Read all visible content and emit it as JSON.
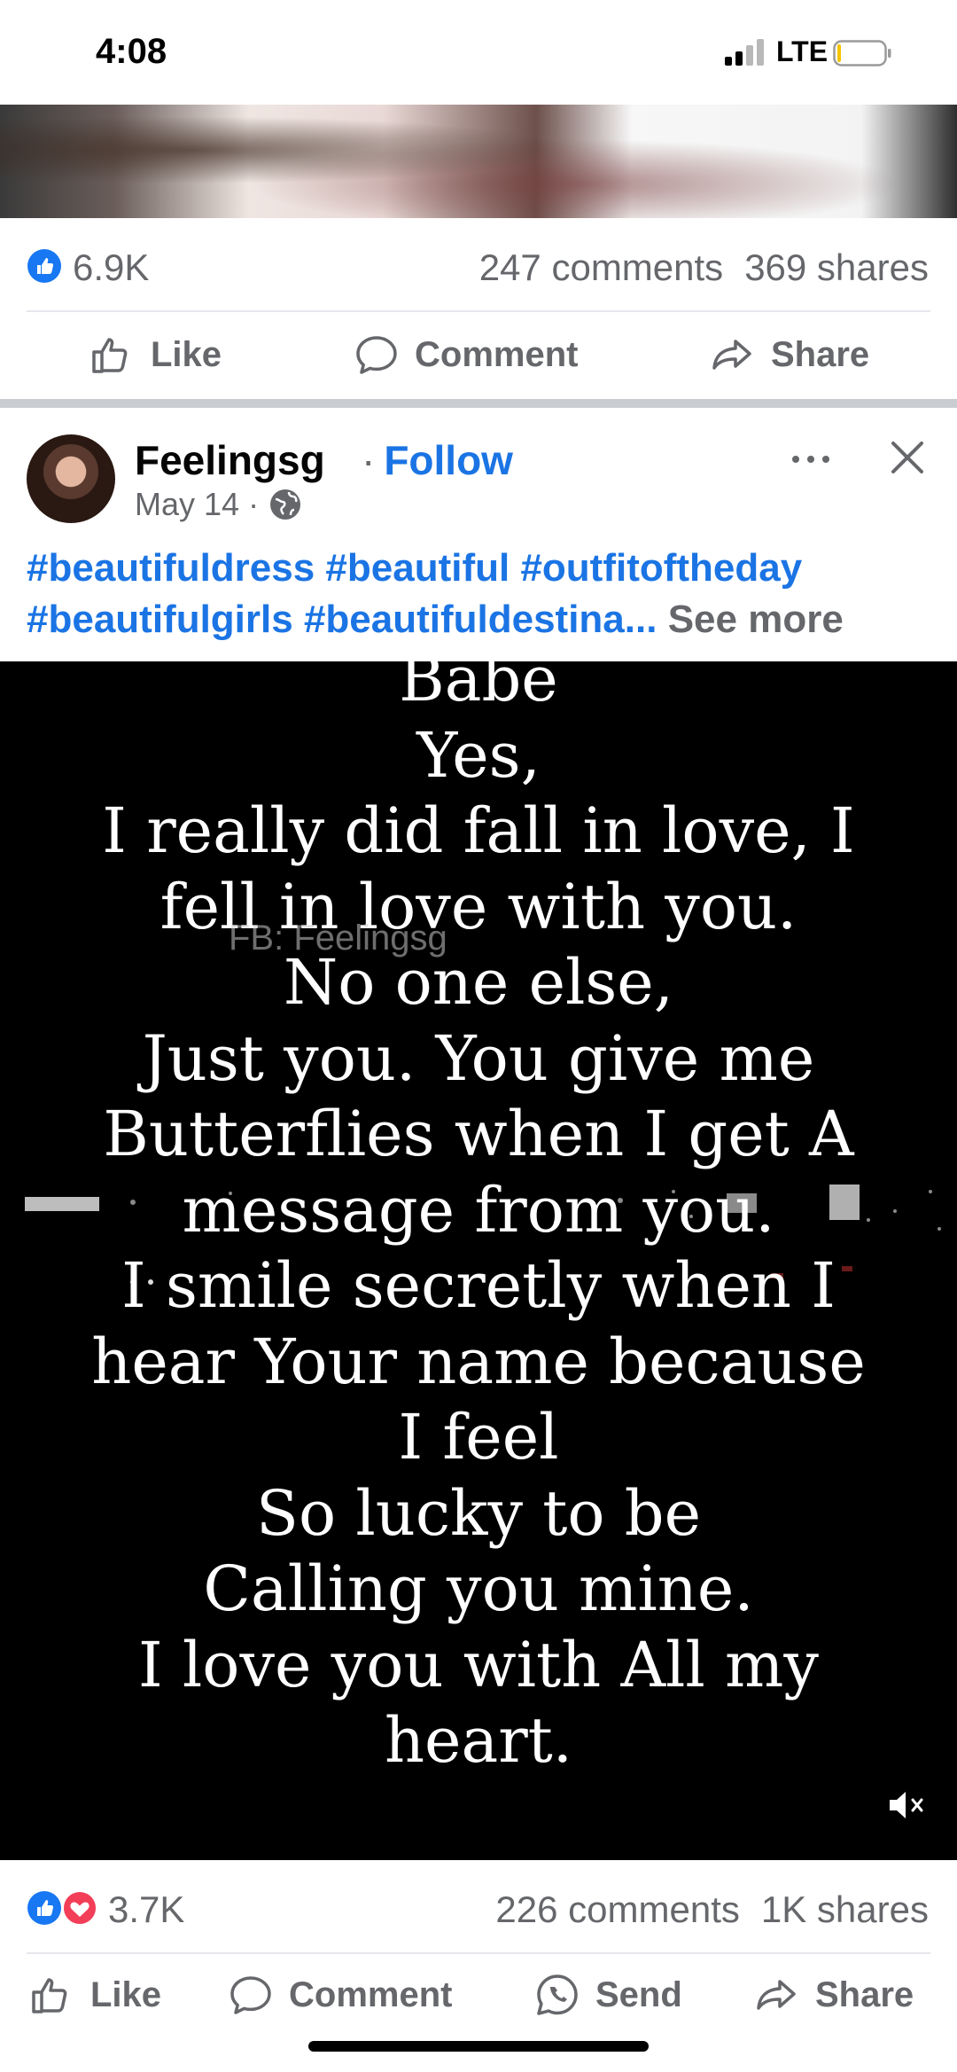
{
  "status_bar": {
    "time": "4:08",
    "network": "LTE"
  },
  "post1": {
    "reaction_count": "6.9K",
    "comments": "247 comments",
    "shares": "369 shares",
    "actions": {
      "like": "Like",
      "comment": "Comment",
      "share": "Share"
    }
  },
  "post2": {
    "author": "Feelingsg",
    "follow_label": "Follow",
    "date": "May 14",
    "caption_line1": "#beautifuldress #beautiful #outfitoftheday",
    "caption_line2": "#beautifulgirls #beautifuldestina...",
    "see_more": "See more",
    "video_text": [
      "Babe",
      "Yes,",
      "I really did fall in love, I",
      "fell in love with you.",
      "No one else,",
      "Just you. You give me",
      "Butterflies when I get A",
      "message from you.",
      "I smile secretly when I",
      "hear Your name because",
      "I feel",
      "So lucky to be",
      "Calling you mine.",
      "I love you with All my",
      "heart."
    ],
    "watermark": "FB: Feelingsg",
    "reaction_count": "3.7K",
    "comments": "226 comments",
    "shares": "1K shares",
    "actions": {
      "like": "Like",
      "comment": "Comment",
      "send": "Send",
      "share": "Share"
    }
  },
  "colors": {
    "link_blue": "#1b74e4",
    "gray_text": "#65676b",
    "like_blue": "#1877f2",
    "love_red": "#f33e58"
  }
}
